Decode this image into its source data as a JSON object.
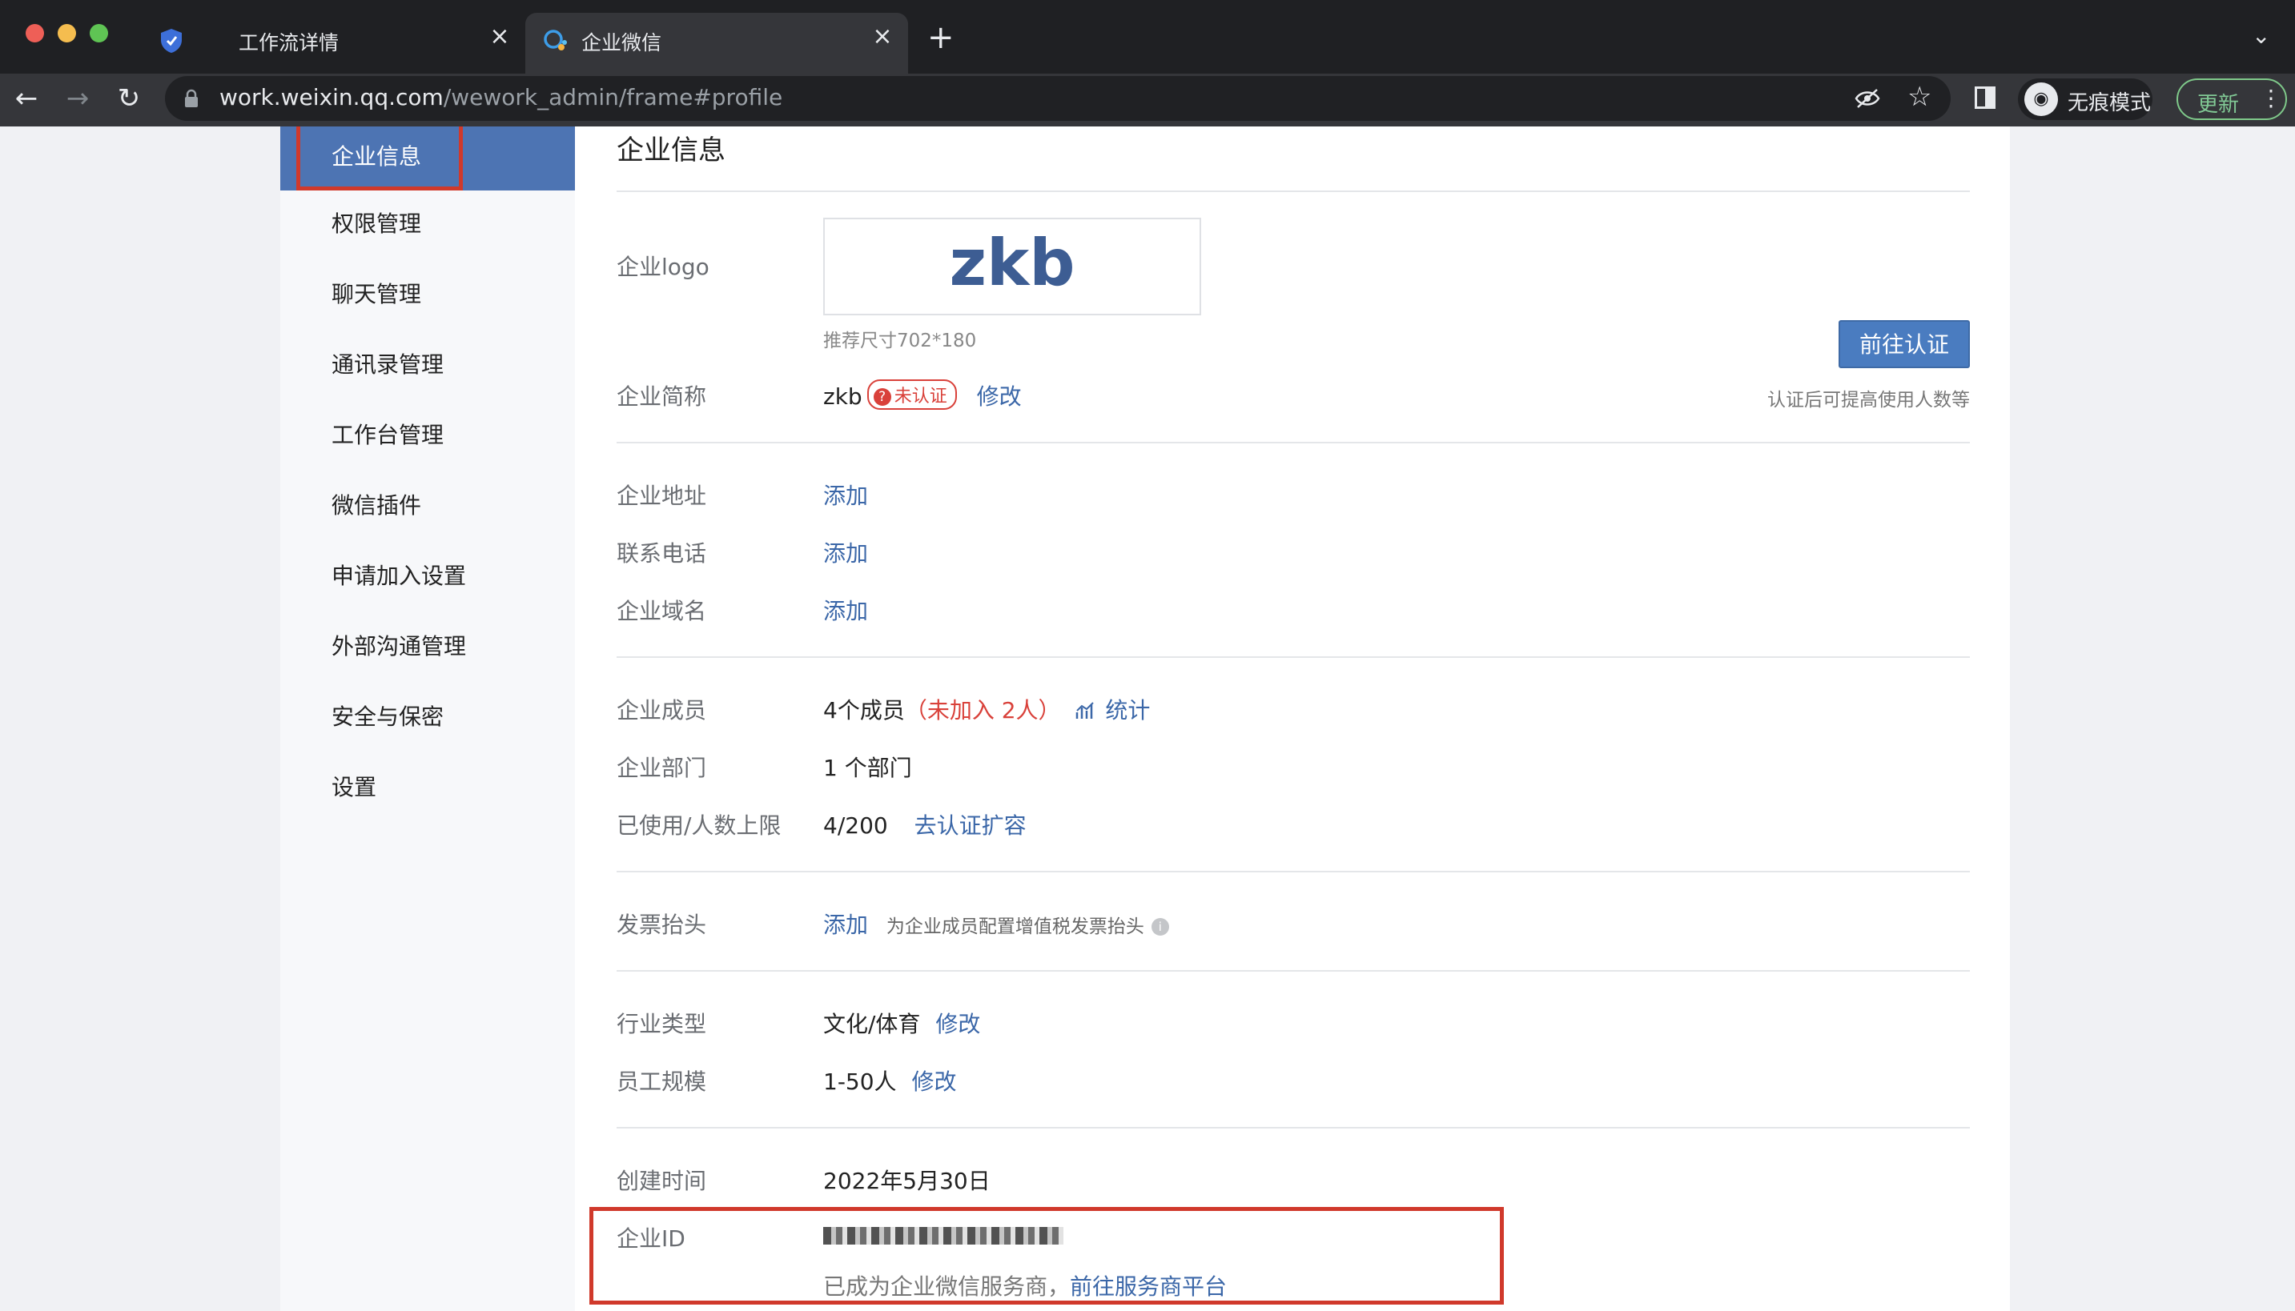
{
  "browser": {
    "tabs": [
      {
        "label": "工作流详情",
        "active": false
      },
      {
        "label": "企业微信",
        "active": true
      }
    ],
    "new_tab": "+",
    "url_host": "work.weixin.qq.com",
    "url_path": "/wework_admin/frame#profile",
    "incognito_label": "无痕模式",
    "update_label": "更新"
  },
  "sidebar": {
    "items": [
      {
        "label": "企业信息",
        "active": true
      },
      {
        "label": "权限管理"
      },
      {
        "label": "聊天管理"
      },
      {
        "label": "通讯录管理"
      },
      {
        "label": "工作台管理"
      },
      {
        "label": "微信插件"
      },
      {
        "label": "申请加入设置"
      },
      {
        "label": "外部沟通管理"
      },
      {
        "label": "安全与保密"
      },
      {
        "label": "设置"
      }
    ]
  },
  "main": {
    "title": "企业信息",
    "logo": {
      "label": "企业logo",
      "text": "zkb",
      "hint": "推荐尺寸702*180"
    },
    "verify_button": "前往认证",
    "verify_hint": "认证后可提高使用人数等",
    "short_name": {
      "label": "企业简称",
      "value": "zkb",
      "badge": "未认证",
      "edit": "修改"
    },
    "address": {
      "label": "企业地址",
      "action": "添加"
    },
    "phone": {
      "label": "联系电话",
      "action": "添加"
    },
    "domain": {
      "label": "企业域名",
      "action": "添加"
    },
    "members": {
      "label": "企业成员",
      "value": "4个成员",
      "not_joined": "（未加入 2人）",
      "stats": "统计"
    },
    "departments": {
      "label": "企业部门",
      "value": "1 个部门"
    },
    "usage": {
      "label": "已使用/人数上限",
      "value": "4/200",
      "action": "去认证扩容"
    },
    "invoice": {
      "label": "发票抬头",
      "action": "添加",
      "hint": "为企业成员配置增值税发票抬头"
    },
    "industry": {
      "label": "行业类型",
      "value": "文化/体育",
      "edit": "修改"
    },
    "scale": {
      "label": "员工规模",
      "value": "1-50人",
      "edit": "修改"
    },
    "created": {
      "label": "创建时间",
      "value": "2022年5月30日"
    },
    "corp_id": {
      "label": "企业ID",
      "provider_note": "已成为企业微信服务商，",
      "provider_link": "前往服务商平台"
    }
  },
  "colors": {
    "accent": "#4d74b3",
    "link": "#3b67a8",
    "warning": "#d9413a",
    "annotation": "#d0392b"
  }
}
